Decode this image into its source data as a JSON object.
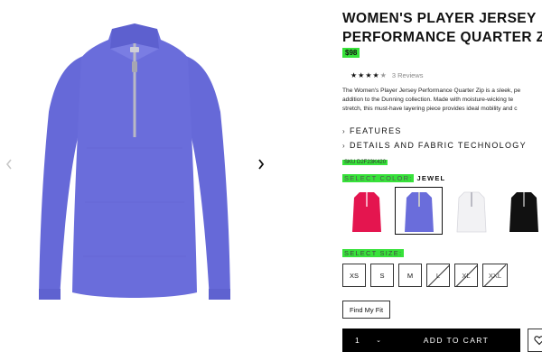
{
  "product": {
    "title_line1": "WOMEN'S PLAYER JERSEY",
    "title_line2": "PERFORMANCE QUARTER ZIP",
    "price": "$98",
    "rating": 4.5,
    "reviews": "3 Reviews",
    "description": [
      "The Women's Player Jersey Performance Quarter Zip is a sleek, pe",
      "addition to the Dunning collection. Made with moisture-wicking te",
      "stretch, this must-have layering piece provides ideal mobility and c"
    ],
    "image_color": "#6a6ddb"
  },
  "accordions": [
    {
      "label": "FEATURES"
    },
    {
      "label": "DETAILS AND FABRIC TECHNOLOGY"
    }
  ],
  "sku": "SKU D2F23K420",
  "color": {
    "label": "SELECT COLOR:",
    "selected": "JEWEL",
    "swatches": [
      {
        "name": "red",
        "hex": "#e4154f",
        "selected": false
      },
      {
        "name": "jewel",
        "hex": "#6a6ddb",
        "selected": true
      },
      {
        "name": "white",
        "hex": "#f2f2f4",
        "selected": false
      },
      {
        "name": "black",
        "hex": "#111111",
        "selected": false
      }
    ]
  },
  "size": {
    "label": "SELECT SIZE:",
    "options": [
      {
        "label": "XS",
        "available": true
      },
      {
        "label": "S",
        "available": true
      },
      {
        "label": "M",
        "available": true
      },
      {
        "label": "L",
        "available": false
      },
      {
        "label": "XL",
        "available": false
      },
      {
        "label": "XXL",
        "available": false
      }
    ]
  },
  "find_fit": "Find My Fit",
  "cart": {
    "quantity": "1",
    "add_label": "ADD TO CART"
  },
  "colors": {
    "highlight": "#37e23a",
    "button_bg": "#000000"
  },
  "icons": {
    "prev": "chevron-left-icon",
    "next": "chevron-right-icon",
    "wishlist": "heart-icon"
  }
}
